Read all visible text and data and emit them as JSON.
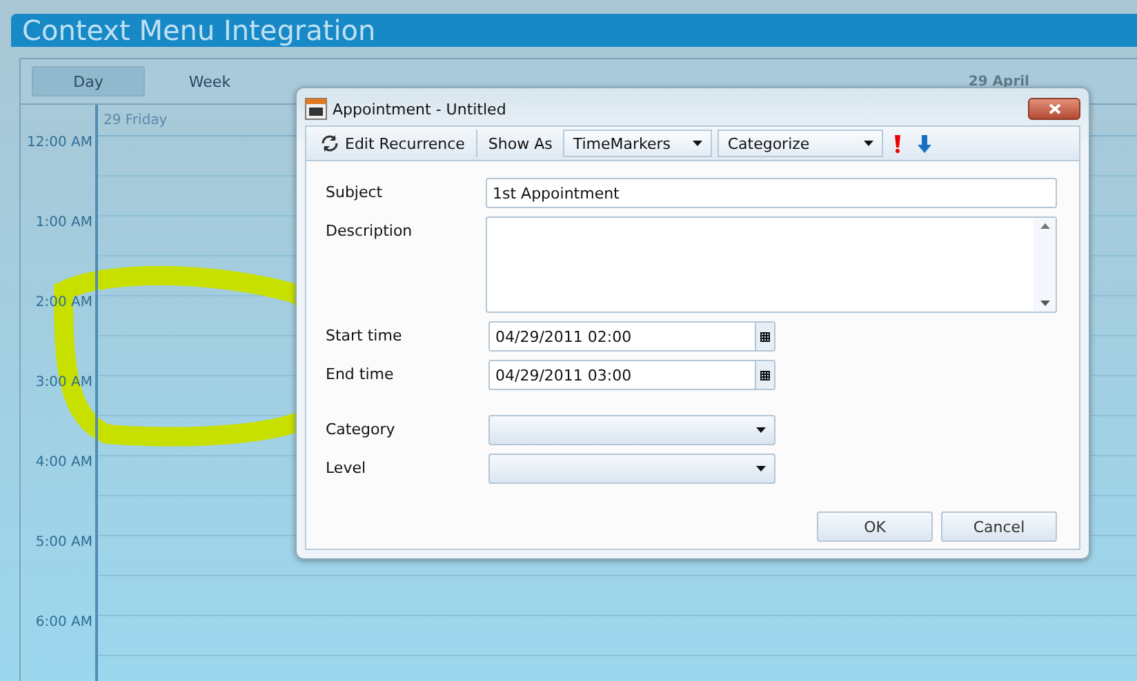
{
  "app": {
    "title": "Context Menu Integration"
  },
  "scheduler": {
    "view_tabs": [
      {
        "label": "Day",
        "selected": true
      },
      {
        "label": "Week",
        "selected": false
      }
    ],
    "date_label": "29 April",
    "day_header": "29 Friday",
    "time_slots": [
      "12:00 AM",
      "1:00 AM",
      "2:00 AM",
      "3:00 AM",
      "4:00 AM",
      "5:00 AM",
      "6:00 AM"
    ]
  },
  "dialog": {
    "title": "Appointment - Untitled",
    "toolbar": {
      "edit_recurrence": "Edit Recurrence",
      "show_as_label": "Show As",
      "show_as_value": "TimeMarkers",
      "categorize": "Categorize"
    },
    "fields": [
      {
        "kind": "text",
        "label": "Subject",
        "value": "1st Appointment"
      },
      {
        "kind": "multiline",
        "label": "Description"
      },
      {
        "kind": "datetime",
        "label": "Start time",
        "value": "04/29/2011 02:00"
      },
      {
        "kind": "datetime",
        "label": "End time",
        "value": "04/29/2011 03:00"
      },
      {
        "kind": "select",
        "label": "Category"
      },
      {
        "kind": "select",
        "label": "Level"
      }
    ],
    "buttons": [
      "OK",
      "Cancel"
    ]
  }
}
